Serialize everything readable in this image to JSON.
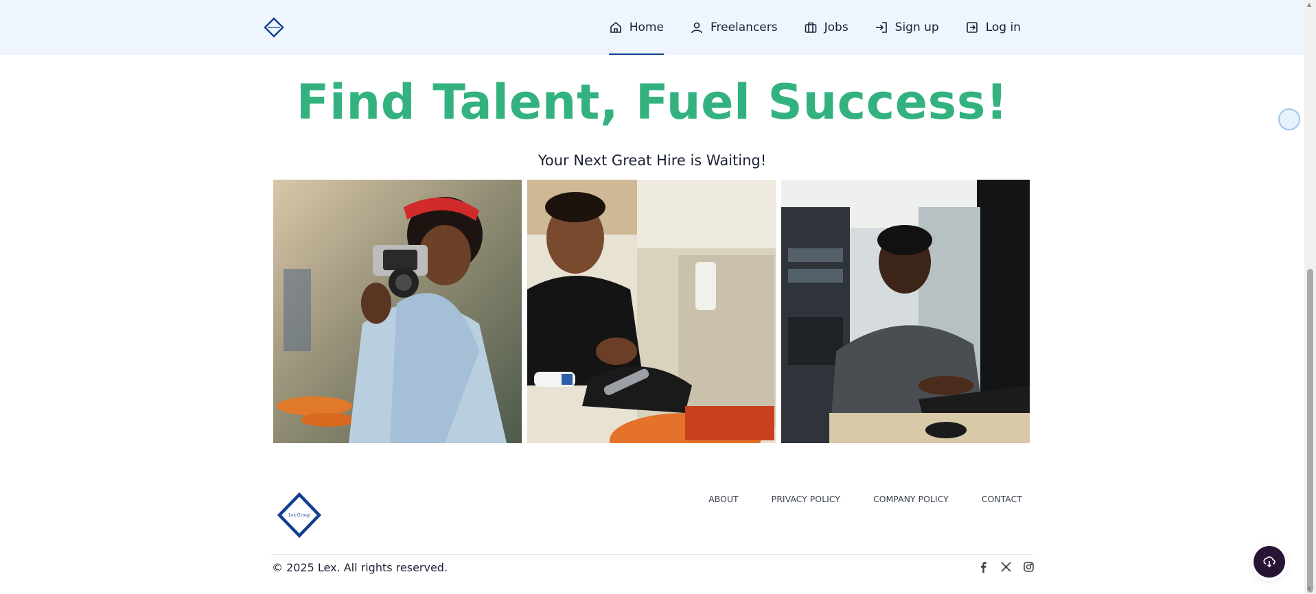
{
  "nav": {
    "items": [
      {
        "label": "Home",
        "icon": "home-icon",
        "active": true
      },
      {
        "label": "Freelancers",
        "icon": "user-icon",
        "active": false
      },
      {
        "label": "Jobs",
        "icon": "briefcase-icon",
        "active": false
      },
      {
        "label": "Sign up",
        "icon": "sign-in-icon",
        "active": false
      },
      {
        "label": "Log in",
        "icon": "log-in-icon",
        "active": false
      }
    ]
  },
  "hero": {
    "title": "Find Talent, Fuel Success!",
    "subtitle": "Your Next Great Hire is Waiting!"
  },
  "gallery": [
    {
      "name": "photographer-photo"
    },
    {
      "name": "plumber-photo"
    },
    {
      "name": "it-technician-photo"
    }
  ],
  "footer": {
    "logo_text": "Lex Group",
    "links": [
      "ABOUT",
      "PRIVACY POLICY",
      "COMPANY POLICY",
      "CONTACT"
    ],
    "copyright": "© 2025 Lex. All rights reserved.",
    "socials": [
      "facebook-icon",
      "x-icon",
      "instagram-icon"
    ]
  },
  "colors": {
    "accent_green": "#33b27f",
    "brand_blue": "#123f8f",
    "header_bg": "#eef5fd"
  }
}
